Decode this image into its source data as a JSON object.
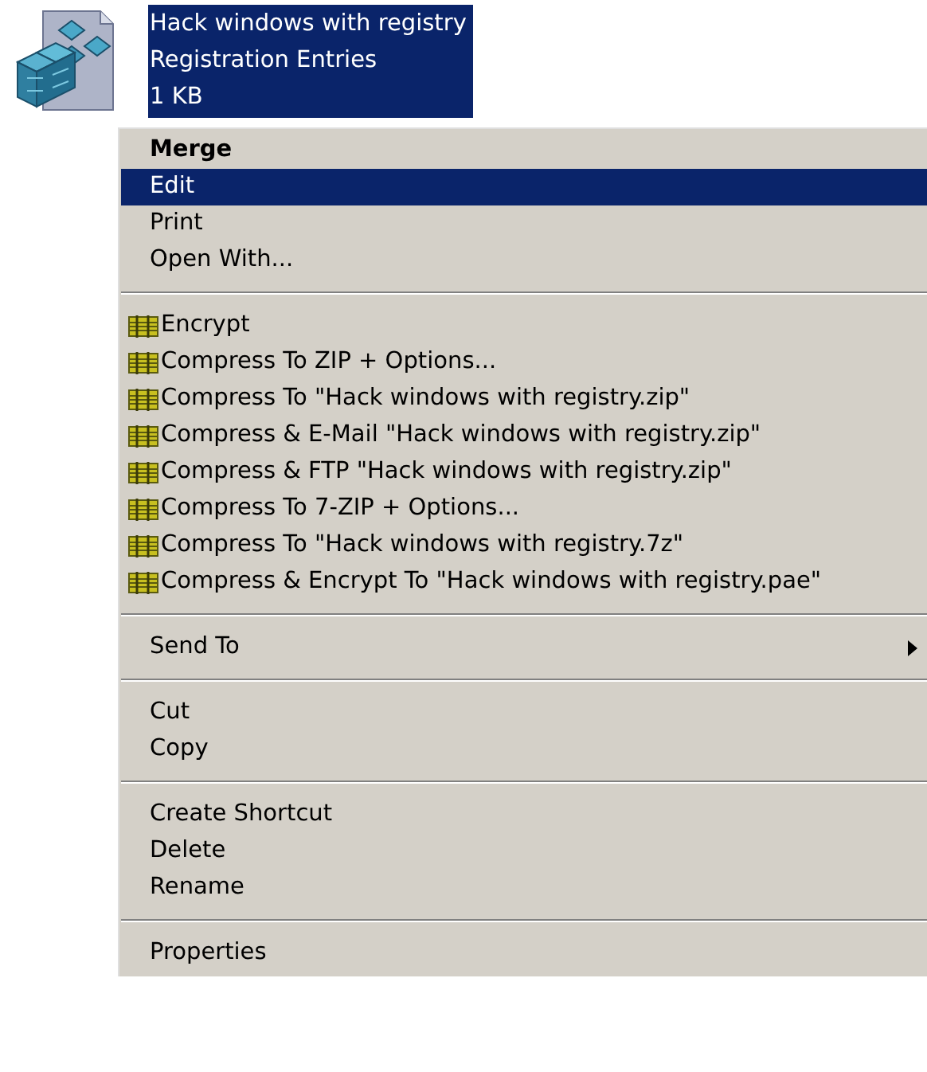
{
  "file": {
    "lines": [
      "Hack windows with registry",
      "Registration Entries",
      "1 KB"
    ],
    "selected": true
  },
  "menu": {
    "groups": [
      [
        {
          "label": "Merge",
          "bold": true,
          "selected": false,
          "kind": "plain"
        },
        {
          "label": "Edit",
          "bold": false,
          "selected": true,
          "kind": "plain"
        },
        {
          "label": "Print",
          "bold": false,
          "selected": false,
          "kind": "plain"
        },
        {
          "label": "Open With...",
          "bold": false,
          "selected": false,
          "kind": "plain"
        }
      ],
      [
        {
          "label": "Encrypt",
          "bold": false,
          "selected": false,
          "kind": "archive"
        },
        {
          "label": "Compress To ZIP + Options...",
          "bold": false,
          "selected": false,
          "kind": "archive"
        },
        {
          "label": "Compress To \"Hack windows with registry.zip\"",
          "bold": false,
          "selected": false,
          "kind": "archive"
        },
        {
          "label": "Compress & E-Mail \"Hack windows with registry.zip\"",
          "bold": false,
          "selected": false,
          "kind": "archive"
        },
        {
          "label": "Compress & FTP \"Hack windows with registry.zip\"",
          "bold": false,
          "selected": false,
          "kind": "archive"
        },
        {
          "label": "Compress To 7-ZIP + Options...",
          "bold": false,
          "selected": false,
          "kind": "archive"
        },
        {
          "label": "Compress To \"Hack windows with registry.7z\"",
          "bold": false,
          "selected": false,
          "kind": "archive"
        },
        {
          "label": "Compress & Encrypt To \"Hack windows with registry.pae\"",
          "bold": false,
          "selected": false,
          "kind": "archive"
        }
      ],
      [
        {
          "label": "Send To",
          "bold": false,
          "selected": false,
          "kind": "submenu"
        }
      ],
      [
        {
          "label": "Cut",
          "bold": false,
          "selected": false,
          "kind": "plain"
        },
        {
          "label": "Copy",
          "bold": false,
          "selected": false,
          "kind": "plain"
        }
      ],
      [
        {
          "label": "Create Shortcut",
          "bold": false,
          "selected": false,
          "kind": "plain"
        },
        {
          "label": "Delete",
          "bold": false,
          "selected": false,
          "kind": "plain"
        },
        {
          "label": "Rename",
          "bold": false,
          "selected": false,
          "kind": "plain"
        }
      ],
      [
        {
          "label": "Properties",
          "bold": false,
          "selected": false,
          "kind": "plain"
        }
      ]
    ]
  }
}
